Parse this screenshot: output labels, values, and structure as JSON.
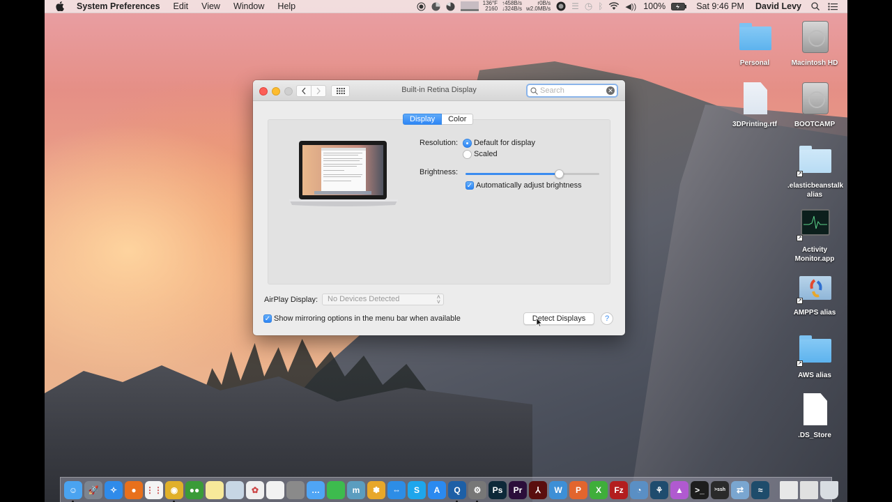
{
  "menubar": {
    "app_name": "System Preferences",
    "menus": [
      "Edit",
      "View",
      "Window",
      "Help"
    ],
    "status": {
      "temp": "136°F",
      "fan": "2160",
      "net_up": "↑458B/s",
      "net_down": "↓324B/s",
      "disk_read": "r0B/s",
      "disk_write": "w2.0MB/s",
      "battery": "100%",
      "clock": "Sat 9:46 PM",
      "user": "David Levy"
    }
  },
  "window": {
    "title": "Built-in Retina Display",
    "search_placeholder": "Search",
    "tabs": [
      {
        "label": "Display",
        "active": true
      },
      {
        "label": "Color",
        "active": false
      }
    ],
    "resolution_label": "Resolution:",
    "resolution_options": [
      {
        "label": "Default for display",
        "selected": true
      },
      {
        "label": "Scaled",
        "selected": false
      }
    ],
    "brightness_label": "Brightness:",
    "brightness_value": 0.7,
    "auto_brightness_label": "Automatically adjust brightness",
    "auto_brightness_checked": true,
    "airplay_label": "AirPlay Display:",
    "airplay_value": "No Devices Detected",
    "mirroring_label": "Show mirroring options in the menu bar when available",
    "mirroring_checked": true,
    "detect_button": "Detect Displays",
    "help_button": "?"
  },
  "desktop_icons": [
    {
      "name": "Personal",
      "type": "folder"
    },
    {
      "name": "Macintosh HD",
      "type": "hdd"
    },
    {
      "name": "3DPrinting.rtf",
      "type": "rtf"
    },
    {
      "name": "BOOTCAMP",
      "type": "hdd"
    },
    {
      "name": ".elasticbeanstalk alias",
      "type": "folder-alias"
    },
    {
      "name": "Activity Monitor.app",
      "type": "app-alias"
    },
    {
      "name": "AMPPS alias",
      "type": "folder-alias"
    },
    {
      "name": "AWS alias",
      "type": "folder-alias"
    },
    {
      "name": ".DS_Store",
      "type": "file"
    }
  ],
  "dock": {
    "apps": [
      {
        "name": "Finder",
        "color": "#4aa3f0",
        "glyph": "☺",
        "running": true
      },
      {
        "name": "Launchpad",
        "color": "#7d8590",
        "glyph": "🚀",
        "running": false
      },
      {
        "name": "Safari",
        "color": "#2f8bea",
        "glyph": "✧",
        "running": false
      },
      {
        "name": "Firefox",
        "color": "#e8701c",
        "glyph": "●",
        "running": false
      },
      {
        "name": "Google Apps",
        "color": "#f4f4f4",
        "glyph": "⋮⋮",
        "running": false
      },
      {
        "name": "Chrome",
        "color": "#e0b02a",
        "glyph": "◉",
        "running": true
      },
      {
        "name": "RoboForm",
        "color": "#3a9b38",
        "glyph": "●●",
        "running": false
      },
      {
        "name": "Notes",
        "color": "#f7e99a",
        "glyph": "",
        "running": false
      },
      {
        "name": "Preview",
        "color": "#c7d6e4",
        "glyph": "",
        "running": false
      },
      {
        "name": "Photos",
        "color": "#f0f0f0",
        "glyph": "✿",
        "running": false
      },
      {
        "name": "TextEdit",
        "color": "#f2f2f2",
        "glyph": "",
        "running": false
      },
      {
        "name": "Calculator",
        "color": "#8a8a8a",
        "glyph": "",
        "running": false
      },
      {
        "name": "Messages",
        "color": "#4fa5f5",
        "glyph": "…",
        "running": false
      },
      {
        "name": "FaceTime",
        "color": "#3dbb4e",
        "glyph": "",
        "running": false
      },
      {
        "name": "Mining",
        "color": "#5b9dbf",
        "glyph": "m",
        "running": false
      },
      {
        "name": "Growl",
        "color": "#e8a72a",
        "glyph": "✽",
        "running": false
      },
      {
        "name": "TeamViewer",
        "color": "#2d8de6",
        "glyph": "⇔",
        "running": false
      },
      {
        "name": "Skype",
        "color": "#1ea6ec",
        "glyph": "S",
        "running": false
      },
      {
        "name": "App Store",
        "color": "#2b8af0",
        "glyph": "A",
        "running": false
      },
      {
        "name": "QuickTime",
        "color": "#1d5fa6",
        "glyph": "Q",
        "running": true
      },
      {
        "name": "System Preferences",
        "color": "#777",
        "glyph": "⚙",
        "running": true
      },
      {
        "name": "Photoshop",
        "color": "#0d2838",
        "glyph": "Ps",
        "running": false
      },
      {
        "name": "Premiere",
        "color": "#2b0e3a",
        "glyph": "Pr",
        "running": false
      },
      {
        "name": "Acrobat",
        "color": "#5a0e0e",
        "glyph": "⅄",
        "running": false
      },
      {
        "name": "Word",
        "color": "#3d8fd6",
        "glyph": "W",
        "running": false
      },
      {
        "name": "PowerPoint",
        "color": "#e2652e",
        "glyph": "P",
        "running": false
      },
      {
        "name": "Excel",
        "color": "#3fae3a",
        "glyph": "X",
        "running": false
      },
      {
        "name": "FileZilla",
        "color": "#b31e1e",
        "glyph": "Fz",
        "running": false
      },
      {
        "name": "AMPPS",
        "color": "#5a8fc4",
        "glyph": "◔",
        "running": false
      },
      {
        "name": "SourceTree",
        "color": "#1f4c6e",
        "glyph": "⚘",
        "running": false
      },
      {
        "name": "Kaleidoscope",
        "color": "#b05ad0",
        "glyph": "▲",
        "running": false
      },
      {
        "name": "Terminal",
        "color": "#1d1d1d",
        "glyph": ">_",
        "running": false
      },
      {
        "name": "SSH Terminal",
        "color": "#2a2a2a",
        "glyph": ">ssh",
        "running": false
      },
      {
        "name": "Network Utility",
        "color": "#7aa6d0",
        "glyph": "⇄",
        "running": false
      },
      {
        "name": "MySQL Workbench",
        "color": "#1e4c6b",
        "glyph": "≈",
        "running": false
      }
    ],
    "stacks": [
      {
        "name": "Documents",
        "color": "#e8e8e8"
      },
      {
        "name": "Downloads",
        "color": "#e0e0e0"
      },
      {
        "name": "Trash",
        "color": "#d8dde2"
      }
    ]
  }
}
